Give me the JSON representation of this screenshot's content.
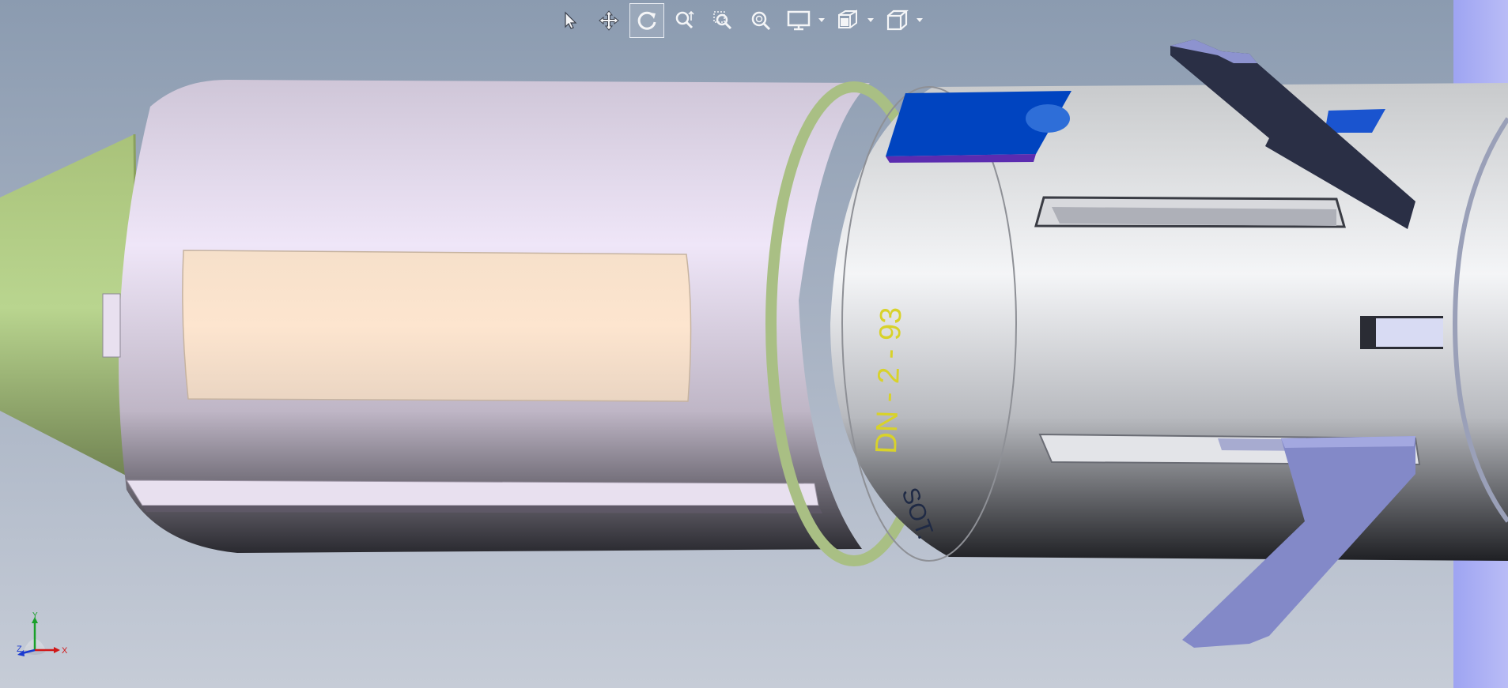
{
  "toolbar": {
    "tools": [
      {
        "id": "select",
        "icon": "select-arrow-icon",
        "active": false
      },
      {
        "id": "pan",
        "icon": "pan-move-icon",
        "active": false
      },
      {
        "id": "rotate",
        "icon": "rotate-icon",
        "active": true
      },
      {
        "id": "zoom",
        "icon": "zoom-icon",
        "active": false
      },
      {
        "id": "zoom-area",
        "icon": "zoom-area-icon",
        "active": false
      },
      {
        "id": "zoom-fit",
        "icon": "zoom-fit-icon",
        "active": false
      }
    ],
    "dropdowns": [
      {
        "id": "display",
        "icon": "display-monitor-icon"
      },
      {
        "id": "section",
        "icon": "section-view-icon"
      },
      {
        "id": "view-orientation",
        "icon": "view-cube-icon"
      }
    ]
  },
  "model": {
    "engraving_label": "DN - 2 - 93",
    "serial_label": "SOT.",
    "colors": {
      "nose_cone": "#b5cf8b",
      "body_tube": "#e6dcef",
      "label_panel": "#fde5cf",
      "right_body": "#e8eaee",
      "blue_part": "#0044c0",
      "dark_fin": "#2a2f45",
      "light_fin": "#8d93cf",
      "engraving_text": "#d8d22a",
      "serial_text": "#1f2a45"
    }
  },
  "axis_triad": {
    "x_label": "X",
    "y_label": "Y",
    "z_label": "Z"
  }
}
